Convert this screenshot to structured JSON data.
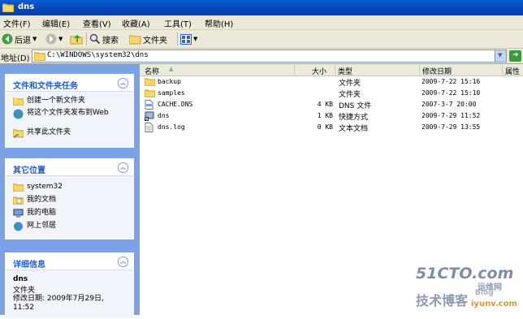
{
  "window": {
    "title": "dns"
  },
  "menu": [
    "文件(F)",
    "编辑(E)",
    "查看(V)",
    "收藏(A)",
    "工具(T)",
    "帮助(H)"
  ],
  "toolbar": {
    "back": "后退",
    "search": "搜索",
    "folders": "文件夹"
  },
  "address": {
    "label": "地址(D)",
    "path": "C:\\WINDOWS\\system32\\dns"
  },
  "tasks": {
    "title": "文件和文件夹任务",
    "items": [
      "创建一个新文件夹",
      "将这个文件夹发布到Web",
      "共享此文件夹"
    ]
  },
  "other_places": {
    "title": "其它位置",
    "items": [
      "system32",
      "我的文档",
      "我的电脑",
      "网上邻居"
    ]
  },
  "details": {
    "title": "详细信息",
    "name": "dns",
    "type": "文件夹",
    "modified": "修改日期: 2009年7月29日, 11:52"
  },
  "columns": {
    "name": "名称",
    "size": "大小",
    "type": "类型",
    "modified": "修改日期",
    "attr": "属性"
  },
  "files": [
    {
      "name": "backup",
      "size": "",
      "type": "文件夹",
      "modified": "2009-7-22 15:16",
      "icon": "folder-icon"
    },
    {
      "name": "samples",
      "size": "",
      "type": "文件夹",
      "modified": "2009-7-22 15:10",
      "icon": "folder-icon"
    },
    {
      "name": "CACHE.DNS",
      "size": "4 KB",
      "type": "DNS 文件",
      "modified": "2007-3-7 20:00",
      "icon": "file-icon"
    },
    {
      "name": "dns",
      "size": "1 KB",
      "type": "快捷方式",
      "modified": "2009-7-29 11:52",
      "icon": "shortcut-icon"
    },
    {
      "name": "dns.log",
      "size": "0 KB",
      "type": "文本文档",
      "modified": "2009-7-29 13:55",
      "icon": "text-file-icon"
    }
  ],
  "watermark": {
    "line1": "51CTO.com",
    "line2": "技术博客",
    "line3": "Blog",
    "line4": "运维网",
    "line5": "iyunv.com"
  }
}
